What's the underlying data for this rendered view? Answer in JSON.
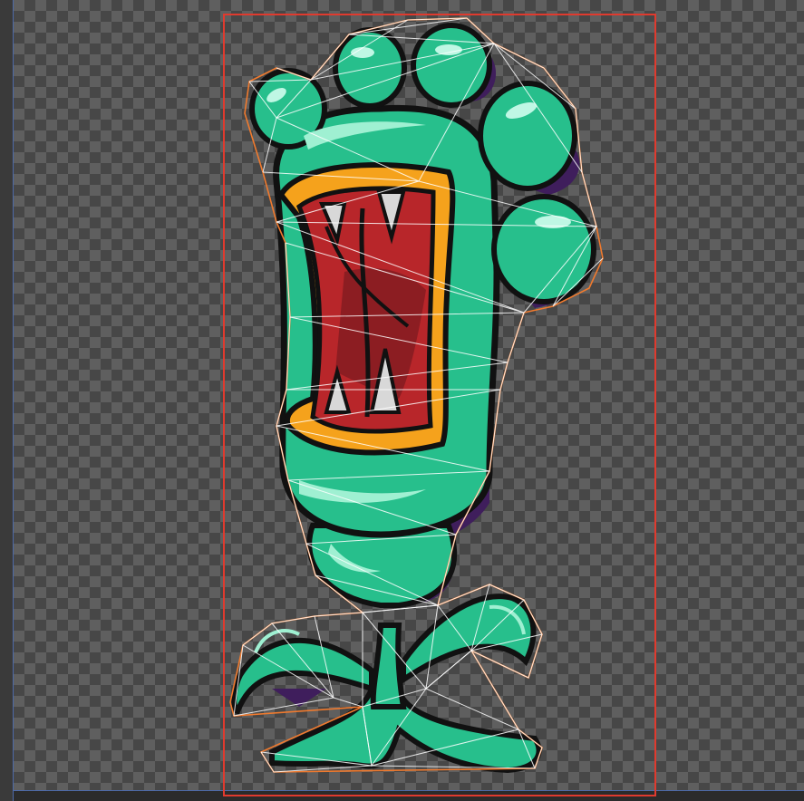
{
  "editor": {
    "sprite_name": "carnivorous-plant-monster",
    "selection_color": "#e03a2e",
    "outline_color": "#f07a2e",
    "mesh_color": "#ffffff",
    "guide_color": "#4d6aa8"
  },
  "sprite_colors": {
    "body_green": "#27bf8c",
    "shadow_purple": "#3f1e5c",
    "outline_black": "#111111",
    "lip_orange": "#f5a21c",
    "mouth_red": "#b8262a",
    "tooth_white": "#d8d8d8"
  }
}
